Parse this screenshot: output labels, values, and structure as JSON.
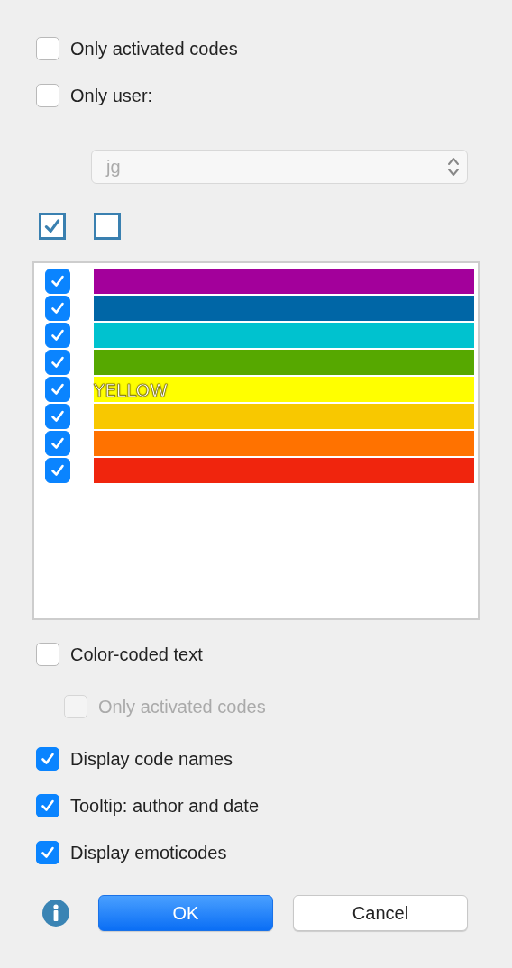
{
  "filters": [
    {
      "label": "Only activated codes",
      "checked": false
    },
    {
      "label": "Only user:",
      "checked": false
    }
  ],
  "user_select": {
    "value": "jg",
    "disabled": true
  },
  "select_buttons": [
    {
      "kind": "all"
    },
    {
      "kind": "none"
    }
  ],
  "codes": [
    {
      "checked": true,
      "color": "#a3009b"
    },
    {
      "checked": true,
      "color": "#0066a6"
    },
    {
      "checked": true,
      "color": "#00c2cf"
    },
    {
      "checked": true,
      "color": "#56a800"
    },
    {
      "checked": true,
      "color": "#ffff00",
      "label": "YELLOW"
    },
    {
      "checked": true,
      "color": "#f8c800"
    },
    {
      "checked": true,
      "color": "#ff7200"
    },
    {
      "checked": true,
      "color": "#f0250d"
    }
  ],
  "options": [
    {
      "label": "Color-coded text",
      "checked": false,
      "disabled": false,
      "children": [
        {
          "label": "Only activated codes",
          "checked": false,
          "disabled": true
        }
      ]
    },
    {
      "label": "Display code names",
      "checked": true,
      "disabled": false
    },
    {
      "label": "Tooltip: author and date",
      "checked": true,
      "disabled": false
    },
    {
      "label": "Display emoticodes",
      "checked": true,
      "disabled": false
    }
  ],
  "buttons": [
    {
      "label": "OK",
      "kind": "primary"
    },
    {
      "label": "Cancel",
      "kind": "secondary"
    }
  ]
}
